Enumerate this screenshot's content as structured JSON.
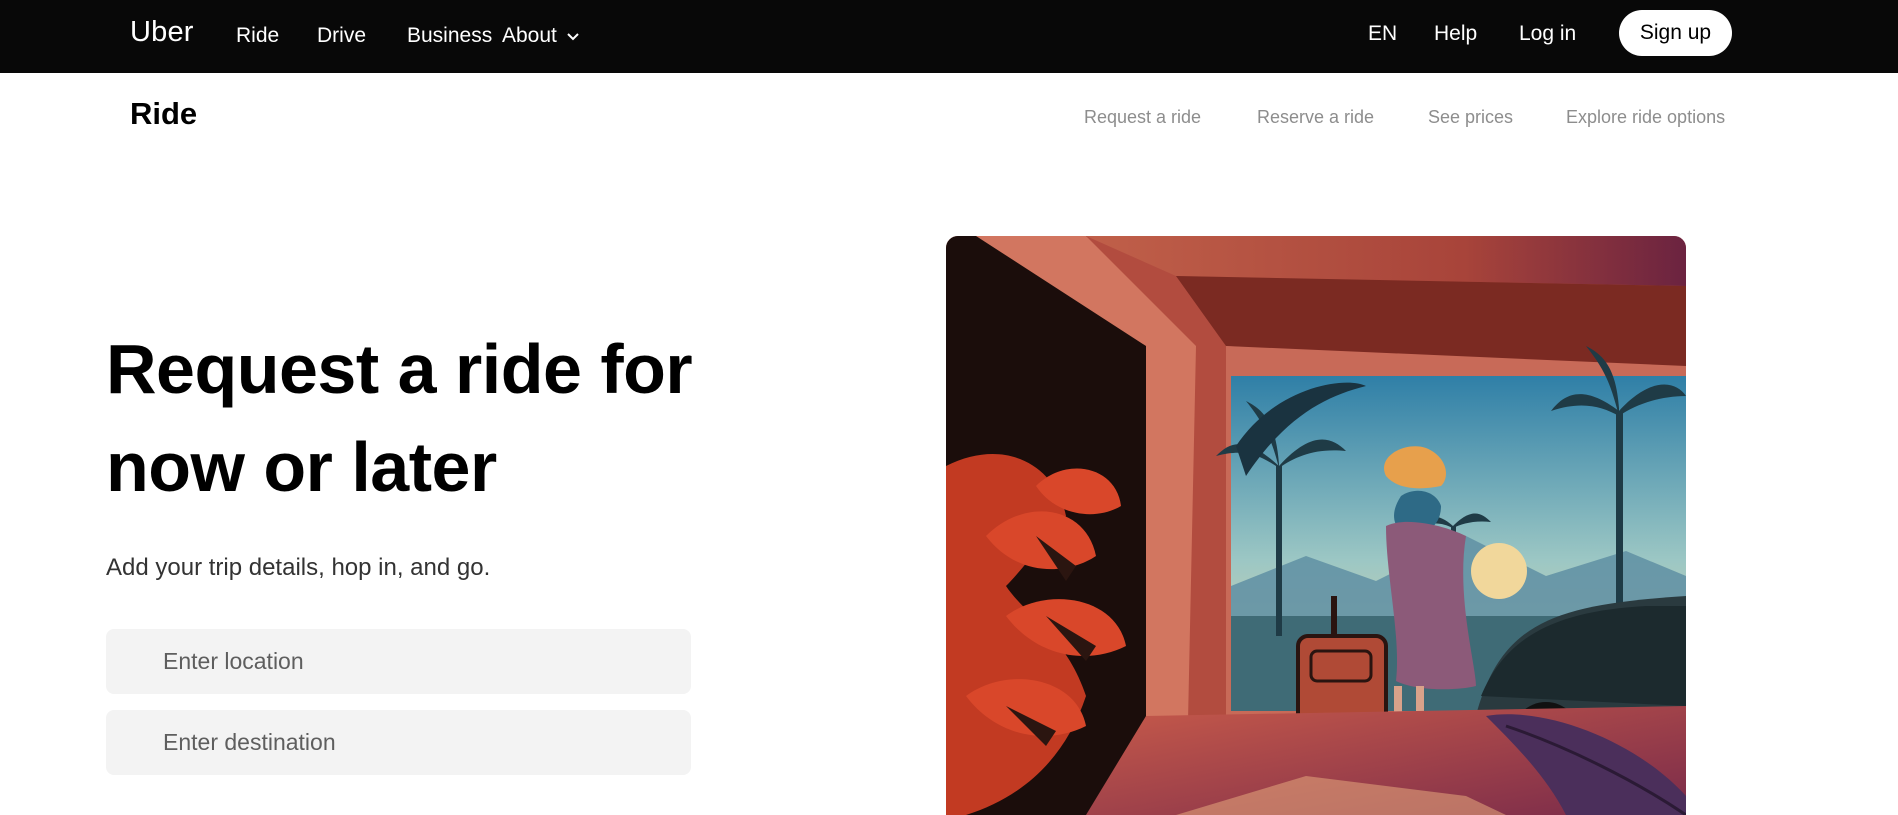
{
  "header": {
    "brand": "Uber",
    "nav": [
      "Ride",
      "Drive",
      "Business",
      "About"
    ],
    "language": "EN",
    "help": "Help",
    "login": "Log in",
    "signup": "Sign up"
  },
  "subheader": {
    "title": "Ride",
    "links": [
      "Request a ride",
      "Reserve a ride",
      "See prices",
      "Explore ride options"
    ]
  },
  "hero": {
    "title_line1": "Request a ride for",
    "title_line2": "now or later",
    "subtitle": "Add your trip details, hop in, and go.",
    "location_placeholder": "Enter location",
    "destination_placeholder": "Enter destination"
  },
  "colors": {
    "topbar": "#080808",
    "field_bg": "#f3f3f3",
    "subnav_text": "#8d8d8d"
  }
}
